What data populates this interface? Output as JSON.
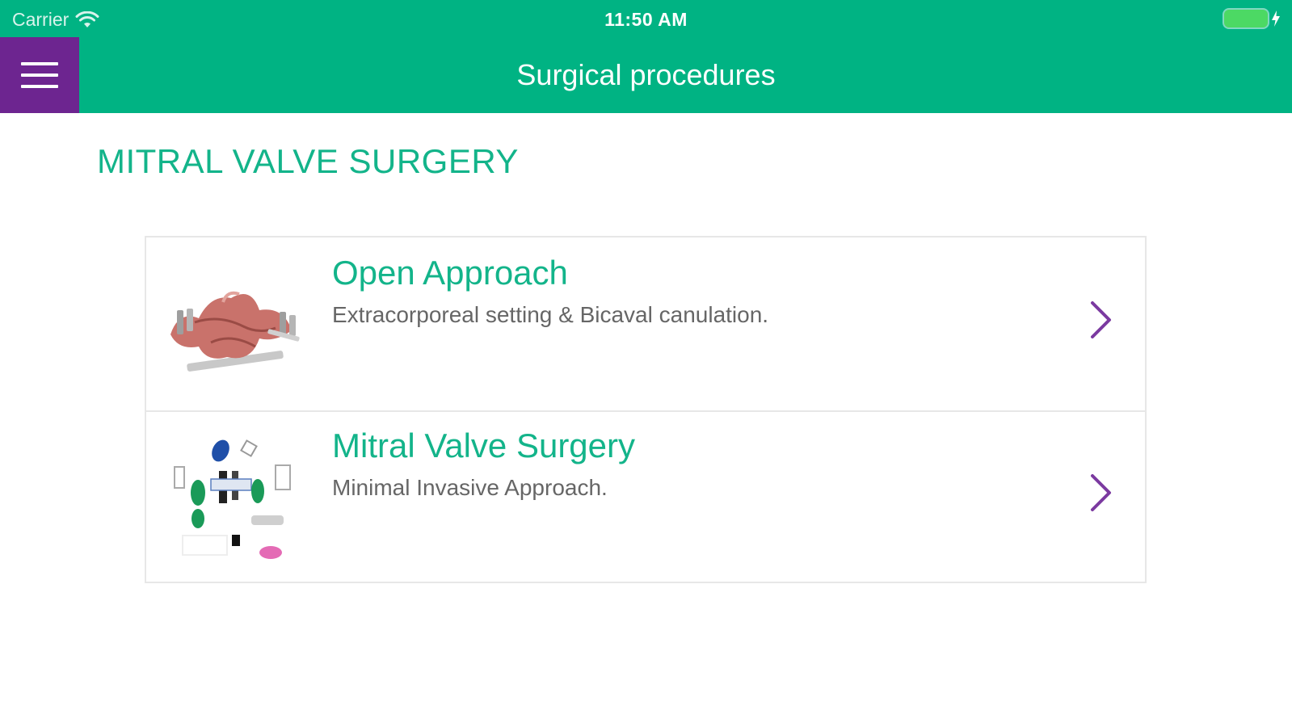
{
  "status_bar": {
    "carrier": "Carrier",
    "time": "11:50 AM",
    "icons": [
      "wifi-icon",
      "battery-icon",
      "charging-bolt-icon"
    ],
    "battery_color": "#4cd964"
  },
  "nav_bar": {
    "title": "Surgical procedures",
    "menu_icon": "hamburger-menu-icon",
    "background": "#00b383",
    "menu_background": "#6d2590"
  },
  "section": {
    "title": "MITRAL VALVE SURGERY"
  },
  "procedures": [
    {
      "title": "Open Approach",
      "subtitle": "Extracorporeal setting & Bicaval canulation.",
      "thumbnail": "heart-anatomy-thumbnail",
      "chevron": "chevron-right-icon"
    },
    {
      "title": "Mitral Valve Surgery",
      "subtitle": "Minimal Invasive Approach.",
      "thumbnail": "surgical-setup-thumbnail",
      "chevron": "chevron-right-icon"
    }
  ],
  "colors": {
    "accent_green": "#13b48a",
    "chevron_purple": "#7b3aa0",
    "subtitle_gray": "#666666"
  }
}
